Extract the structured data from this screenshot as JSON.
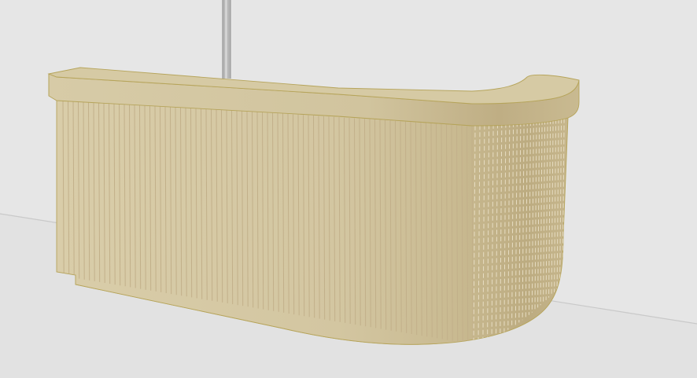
{
  "scene": {
    "object": "reception-desk",
    "colors": {
      "wall": "#e6e6e6",
      "floor": "#e3e3e3",
      "floor_line": "#c9c9c9",
      "pole": "#b8b8b8",
      "pole_outline": "#8f8f8f",
      "top_face": "#d3c6a1",
      "top_edge_light": "#dacfae",
      "top_edge_dark": "#b5a57d",
      "panel_base": "#d6caa6",
      "panel_slat_line": "#c2b08a",
      "panel_shade_right": "#b9a97f",
      "plinth": "#d2c5a0",
      "outline": "#b6a45a"
    }
  }
}
